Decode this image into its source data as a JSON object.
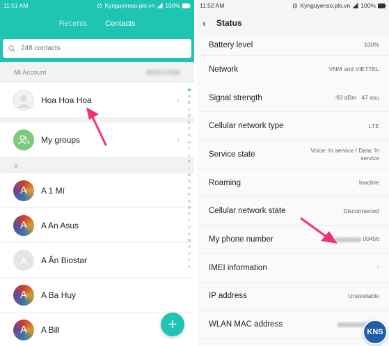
{
  "left": {
    "status": {
      "time": "11:51 AM",
      "site": "Kynguyenso.plo.vn",
      "battery": "100%"
    },
    "tabs": [
      {
        "label": "Recents",
        "active": false
      },
      {
        "label": "Contacts",
        "active": true
      }
    ],
    "search": {
      "placeholder": "248 contacts"
    },
    "account": {
      "label": "Mi Account"
    },
    "profile": {
      "name": "Hoa Hoa Hoa"
    },
    "groups": {
      "name": "My groups"
    },
    "section_letter": "A",
    "contacts": [
      {
        "initial": "A",
        "name": "A 1 Mí",
        "style": "colorful"
      },
      {
        "initial": "A",
        "name": "A An Asus",
        "style": "colorful"
      },
      {
        "initial": "A",
        "name": "A Ân Biostar",
        "style": "grey"
      },
      {
        "initial": "A",
        "name": "A Ba Huy",
        "style": "colorful"
      },
      {
        "initial": "A",
        "name": "A Bill",
        "style": "colorful"
      }
    ],
    "index_letters": [
      "A",
      "B",
      "C",
      "D",
      "E",
      "F",
      "G",
      "H",
      "I",
      "J",
      "K",
      "L",
      "M",
      "N",
      "O",
      "P",
      "Q",
      "R",
      "S",
      "T",
      "U",
      "V",
      "W",
      "X",
      "Y",
      "Z",
      "#"
    ],
    "fab_label": "+"
  },
  "right": {
    "status": {
      "time": "11:52 AM",
      "site": "Kynguyenso.plo.vn",
      "battery": "100%"
    },
    "title": "Status",
    "rows": [
      {
        "label": "Battery level",
        "value": "100%"
      },
      {
        "label": "Network",
        "value": "VNM and VIETTEL"
      },
      {
        "label": "Signal strength",
        "value": "-93 dBm   47 asu"
      },
      {
        "label": "Cellular network type",
        "value": "LTE"
      },
      {
        "label": "Service state",
        "value": "Voice: In service / Data: In service"
      },
      {
        "label": "Roaming",
        "value": "Inactive"
      },
      {
        "label": "Cellular network state",
        "value": "Disconnected"
      },
      {
        "label": "My phone number",
        "value": "00456"
      },
      {
        "label": "IMEI information",
        "value": ""
      },
      {
        "label": "IP address",
        "value": "Unavailable"
      },
      {
        "label": "WLAN MAC address",
        "value": ""
      }
    ],
    "watermark": "KNS"
  },
  "colors": {
    "accent": "#20c4b3",
    "annotation": "#f0336b"
  }
}
